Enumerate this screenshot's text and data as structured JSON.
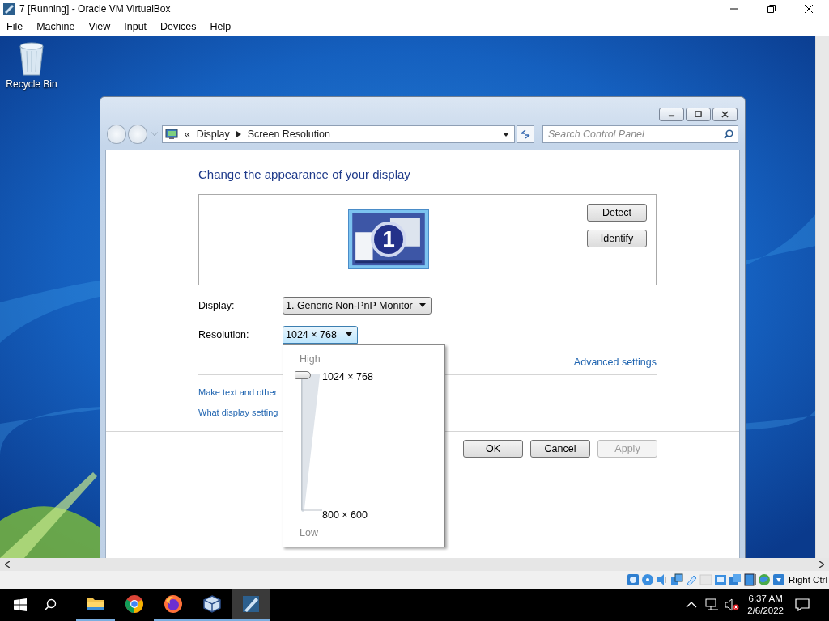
{
  "vbox": {
    "title": "7 [Running] - Oracle VM VirtualBox",
    "menu": [
      "File",
      "Machine",
      "View",
      "Input",
      "Devices",
      "Help"
    ],
    "host_key": "Right Ctrl"
  },
  "desktop": {
    "icons": [
      {
        "label": "Recycle Bin"
      }
    ]
  },
  "window": {
    "address": {
      "overflow": "«",
      "crumbs": [
        "Display",
        "Screen Resolution"
      ]
    },
    "search": {
      "placeholder": "Search Control Panel"
    },
    "heading": "Change the appearance of your display",
    "monitor_number": "1",
    "monitor_buttons": [
      "Detect",
      "Identify"
    ],
    "fields": [
      {
        "label": "Display:",
        "value": "1. Generic Non-PnP Monitor",
        "expanded": false
      },
      {
        "label": "Resolution:",
        "value": "1024 × 768",
        "expanded": true
      }
    ],
    "advanced_link": "Advanced settings",
    "links": [
      "Make text and other",
      "What display setting"
    ],
    "buttons": [
      {
        "label": "OK",
        "disabled": false
      },
      {
        "label": "Cancel",
        "disabled": false
      },
      {
        "label": "Apply",
        "disabled": true
      }
    ],
    "resolution_popup": {
      "high": "High",
      "low": "Low",
      "top": "1024 × 768",
      "bottom": "800 × 600",
      "level": 1
    }
  },
  "taskbar": {
    "apps": [
      {
        "kind": "folder",
        "running": true,
        "selected": false
      },
      {
        "kind": "chrome",
        "running": false,
        "selected": false
      },
      {
        "kind": "firefox",
        "running": true,
        "selected": false
      },
      {
        "kind": "cube",
        "running": true,
        "selected": false
      },
      {
        "kind": "vm",
        "running": true,
        "selected": true
      }
    ],
    "time": "6:37 AM",
    "date": "2/6/2022"
  }
}
